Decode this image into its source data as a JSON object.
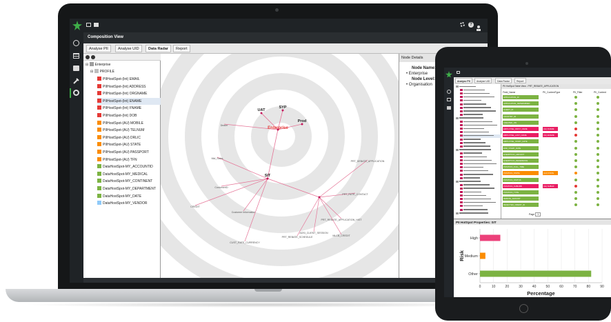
{
  "laptop": {
    "composition_title": "Composition View",
    "tabs": [
      {
        "label": "Analyse PII"
      },
      {
        "label": "Analyse UID"
      },
      {
        "label": "Data Radar"
      },
      {
        "label": "Report"
      }
    ],
    "tree": {
      "root": "Enterprise",
      "profile": "PROFILE",
      "items": [
        {
          "label": "PIIHostSpot-(Int) EMAIL",
          "color": "#e53935"
        },
        {
          "label": "PIIHostSpot-(Int) ADDRESS",
          "color": "#e53935"
        },
        {
          "label": "PIIHostSpot-(Int) ORGNAME",
          "color": "#e53935"
        },
        {
          "label": "PIIHostSpot-(Int) ENAME",
          "color": "#e53935"
        },
        {
          "label": "PIIHostSpot-(Int) FNAME",
          "color": "#e53935"
        },
        {
          "label": "PIIHostSpot-(Int) DOB",
          "color": "#e53935"
        },
        {
          "label": "PIIHostSpot-(AU) MOBILE",
          "color": "#fb8c00"
        },
        {
          "label": "PIIHostSpot-(AU) TELNUM",
          "color": "#fb8c00"
        },
        {
          "label": "PIIHostSpot-(AU) DRLIC",
          "color": "#fb8c00"
        },
        {
          "label": "PIIHostSpot-(AU) STATE",
          "color": "#fb8c00"
        },
        {
          "label": "PIIHostSpot-(AU) PASSPORT",
          "color": "#fb8c00"
        },
        {
          "label": "PIIHostSpot-(AU) TFN",
          "color": "#fb8c00"
        },
        {
          "label": "DataHostSpot-MY_ACCOUNTID",
          "color": "#7cb342"
        },
        {
          "label": "DataHostSpot-MY_MEDICAL",
          "color": "#7cb342"
        },
        {
          "label": "DataHostSpot-MY_CONTINENT",
          "color": "#7cb342"
        },
        {
          "label": "DataHostSpot-MY_DEPARTMENT",
          "color": "#7cb342"
        },
        {
          "label": "DataHostSpot-MY_DATE",
          "color": "#7cb342"
        },
        {
          "label": "DataHostSpot-MY_VENDOR",
          "color": "#90caf9"
        }
      ]
    },
    "radar": {
      "nodes": [
        "Enterprise",
        "SYP",
        "SIT",
        "UAT",
        "Prod"
      ],
      "leaf_labels": [
        "Dealer",
        "Mid_Sales",
        "CustomerID",
        "CREDIT",
        "Customer Information",
        "PRT_DEBATE_APPLICATION",
        "PRT_RATE_CONTACT",
        "PRT_REBATE_APPLICATION_HIST",
        "CUST_RATE_CURRENCY",
        "PRT_REBATE_SCHEDULE",
        "ADSI_CLIENT_SESSION",
        "MLCB_CREDIT"
      ]
    },
    "details": {
      "header": "Node Details",
      "node_name_label": "Node Name:",
      "node_name_value": "Enterprise",
      "node_level_label": "Node Level:",
      "node_level_value": "Organisation"
    }
  },
  "tablet": {
    "tabs": [
      {
        "label": "Analyse PII"
      },
      {
        "label": "Analyse UID"
      },
      {
        "label": "Data Radar"
      },
      {
        "label": "Report"
      }
    ],
    "grid_title": "PII HotSpot Table View - PRT_REBATE_APPLICATION",
    "grid_headers": [
      "Field_Name",
      "PII_ContentType",
      "PII_Filter",
      "PII_Content"
    ],
    "grid_rows": [
      {
        "field": "APPLICATION_ID",
        "color": "#7cb342",
        "status": "#7cb342"
      },
      {
        "field": "APPLICATION_DETERMINED",
        "color": "#7cb342",
        "status": "#7cb342"
      },
      {
        "field": "CLIENT_ID",
        "color": "#7cb342",
        "status": "#7cb342"
      },
      {
        "field": "COUNTRY_ID",
        "color": "#7cb342",
        "status": "#7cb342"
      },
      {
        "field": "CREATED_ON",
        "color": "#7cb342",
        "status": "#7cb342"
      },
      {
        "field": "EMPLOYEE_FIRST_NAME",
        "color": "#e91e63",
        "tag": "(Int) FNAME",
        "status": "#e53935"
      },
      {
        "field": "EMPLOYEE_LAST_NAME",
        "color": "#e91e63",
        "tag": "(Int) ENAME",
        "status": "#e53935"
      },
      {
        "field": "EMPLOYEE_START_DATE",
        "color": "#7cb342",
        "status": "#7cb342"
      },
      {
        "field": "END_START_DATE",
        "color": "#7cb342",
        "status": "#7cb342"
      },
      {
        "field": "EXEMPTION_AMOUNT",
        "color": "#7cb342",
        "status": "#7cb342"
      },
      {
        "field": "EXEMPTION_REFERENCE",
        "color": "#7cb342",
        "status": "#7cb342"
      },
      {
        "field": "POSITION_FULL_TIME",
        "color": "#7cb342",
        "status": "#7cb342"
      },
      {
        "field": "POSITION_STATE",
        "color": "#fb8c00",
        "tag": "(AU) STATE",
        "status": "#fb8c00"
      },
      {
        "field": "POSITION_STATUS",
        "color": "#7cb342",
        "status": "#7cb342"
      },
      {
        "field": "POSITION_SUBURB",
        "color": "#e91e63",
        "tag": "(Int) SUBUR",
        "status": "#e53935"
      },
      {
        "field": "POSITION_TYPE",
        "color": "#7cb342",
        "status": "#7cb342"
      },
      {
        "field": "REBATE_AMOUNT",
        "color": "#7cb342",
        "status": "#7cb342"
      },
      {
        "field": "REJECTED_CREDIT_ID",
        "color": "#7cb342",
        "status": "#7cb342"
      }
    ],
    "page_label": "Page",
    "page_value": "1",
    "chart_title": "PII HotSpot Properties: SIT"
  },
  "chart_data": {
    "type": "bar",
    "orientation": "horizontal",
    "title": "PII HotSpot Properties: SIT",
    "xlabel": "Percentage",
    "ylabel": "Risk",
    "categories": [
      "High",
      "Medium",
      "Other"
    ],
    "values": [
      15,
      4,
      82
    ],
    "colors": {
      "High": "#ec407a",
      "Medium": "#fb8c00",
      "Other": "#7cb342"
    },
    "xlim": [
      0,
      90
    ],
    "xticks": [
      "0",
      "10",
      "20",
      "30",
      "40",
      "50",
      "60",
      "70",
      "80",
      "90"
    ]
  },
  "colors": {
    "brand": "#3fae49",
    "bezel": "#151718"
  }
}
